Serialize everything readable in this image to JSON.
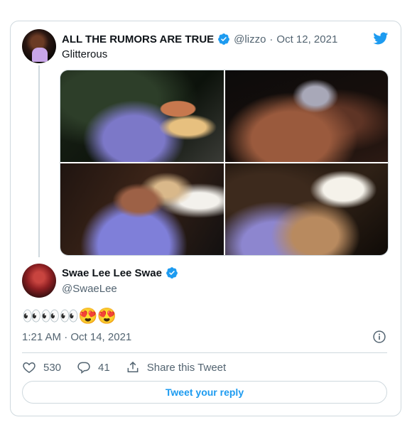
{
  "parent_tweet": {
    "display_name": "ALL THE RUMORS ARE TRUE",
    "handle": "@lizzo",
    "separator": "·",
    "date": "Oct 12, 2021",
    "text": "Glitterous",
    "media_count": 4
  },
  "main_tweet": {
    "display_name": "Swae Lee Lee Swae",
    "handle": "@SwaeLee",
    "text": "👀👀👀😍😍",
    "timestamp": "1:21 AM · Oct 14, 2021"
  },
  "actions": {
    "likes": "530",
    "replies": "41",
    "share_label": "Share this Tweet"
  },
  "reply_button": {
    "label": "Tweet your reply"
  },
  "icons": {
    "brand": "twitter-bird-icon",
    "verified": "verified-badge-icon",
    "info": "info-icon",
    "like": "heart-icon",
    "reply": "reply-icon",
    "share": "share-icon"
  },
  "colors": {
    "accent": "#1d9bf0",
    "text": "#0f1419",
    "muted": "#536471",
    "border": "#cfd9de"
  }
}
